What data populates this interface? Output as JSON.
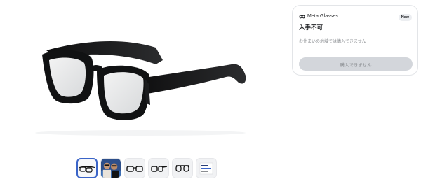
{
  "product": {
    "image_icon": "glasses-image"
  },
  "thumbnails": [
    {
      "icon": "glasses-side-view-thumb",
      "selected": true
    },
    {
      "icon": "lifestyle-photo-thumb",
      "selected": false
    },
    {
      "icon": "glasses-front-view-thumb",
      "selected": false
    },
    {
      "icon": "glasses-angle-view-thumb",
      "selected": false
    },
    {
      "icon": "glasses-top-view-thumb",
      "selected": false
    },
    {
      "icon": "package-box-thumb",
      "selected": false
    }
  ],
  "purchase_card": {
    "brand": "Meta Glasses",
    "badge": "New",
    "status": "入手不可",
    "note": "お住まいの地域では購入できません",
    "button_label": "購入できません"
  },
  "colors": {
    "selected_border": "#3a64c8",
    "button_disabled_bg": "#d3d6db"
  }
}
